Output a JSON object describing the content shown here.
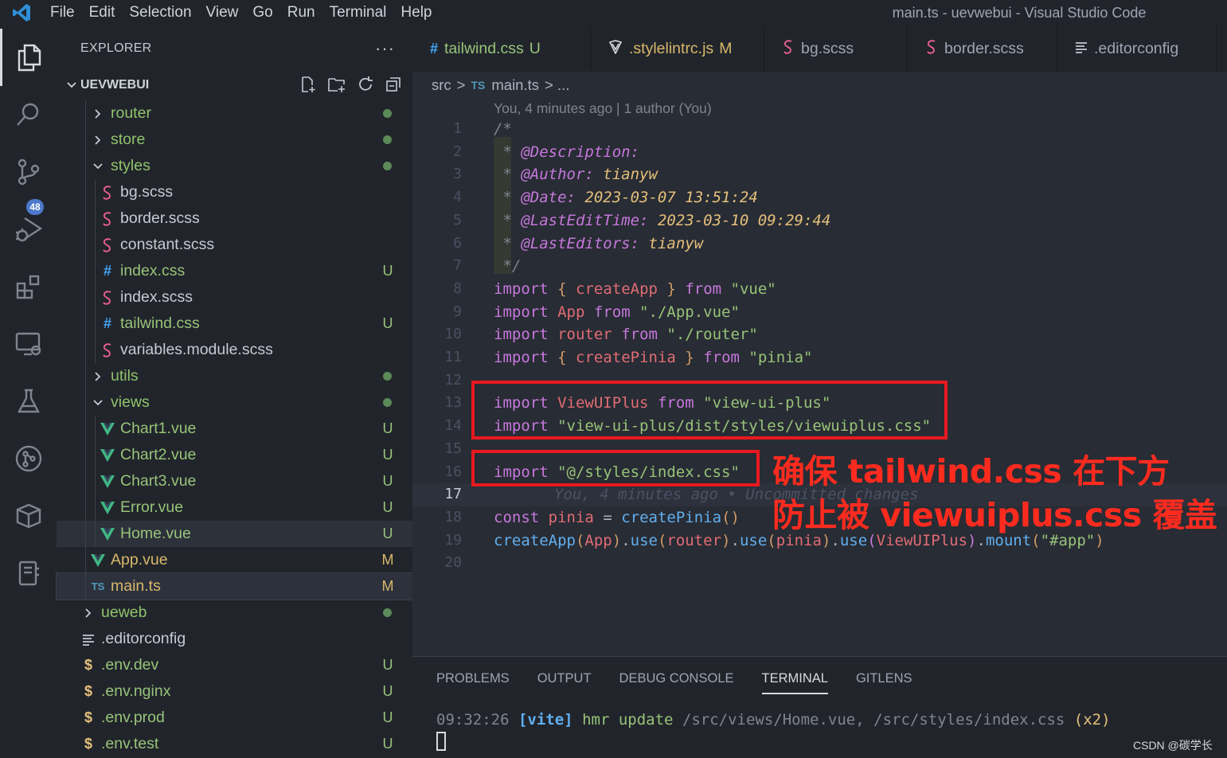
{
  "menu": {
    "items": [
      "File",
      "Edit",
      "Selection",
      "View",
      "Go",
      "Run",
      "Terminal",
      "Help"
    ],
    "window_title": "main.ts - uevwebui - Visual Studio Code"
  },
  "activity": {
    "source_control_badge": "48"
  },
  "explorer": {
    "title": "EXPLORER",
    "more": "···",
    "workspace": "UEVWEBUI",
    "items": [
      {
        "label": "router",
        "kind": "folder",
        "open": false,
        "status": "dot"
      },
      {
        "label": "store",
        "kind": "folder",
        "open": false,
        "status": "dot"
      },
      {
        "label": "styles",
        "kind": "folder",
        "open": true,
        "status": "dot"
      },
      {
        "label": "bg.scss",
        "kind": "scss",
        "status": ""
      },
      {
        "label": "border.scss",
        "kind": "scss",
        "status": ""
      },
      {
        "label": "constant.scss",
        "kind": "scss",
        "status": ""
      },
      {
        "label": "index.css",
        "kind": "css",
        "status": "U"
      },
      {
        "label": "index.scss",
        "kind": "scss",
        "status": ""
      },
      {
        "label": "tailwind.css",
        "kind": "css",
        "status": "U"
      },
      {
        "label": "variables.module.scss",
        "kind": "scss",
        "status": ""
      },
      {
        "label": "utils",
        "kind": "folder",
        "open": false,
        "status": "dot"
      },
      {
        "label": "views",
        "kind": "folder",
        "open": true,
        "status": "dot"
      },
      {
        "label": "Chart1.vue",
        "kind": "vue",
        "status": "U"
      },
      {
        "label": "Chart2.vue",
        "kind": "vue",
        "status": "U"
      },
      {
        "label": "Chart3.vue",
        "kind": "vue",
        "status": "U"
      },
      {
        "label": "Error.vue",
        "kind": "vue",
        "status": "U"
      },
      {
        "label": "Home.vue",
        "kind": "vue",
        "status": "U"
      },
      {
        "label": "App.vue",
        "kind": "vue",
        "status": "M"
      },
      {
        "label": "main.ts",
        "kind": "ts",
        "status": "M"
      },
      {
        "label": "ueweb",
        "kind": "folder",
        "open": false,
        "status": "dot"
      },
      {
        "label": ".editorconfig",
        "kind": "config",
        "status": ""
      },
      {
        "label": ".env.dev",
        "kind": "env",
        "status": "U"
      },
      {
        "label": ".env.nginx",
        "kind": "env",
        "status": "U"
      },
      {
        "label": ".env.prod",
        "kind": "env",
        "status": "U"
      },
      {
        "label": ".env.test",
        "kind": "env",
        "status": "U"
      }
    ]
  },
  "tabs": [
    {
      "label": "tailwind.css",
      "icon": "#",
      "flag": "U"
    },
    {
      "label": ".stylelintrc.js",
      "icon": "stylelint",
      "flag": "M"
    },
    {
      "label": "bg.scss",
      "icon": "scss",
      "flag": ""
    },
    {
      "label": "border.scss",
      "icon": "scss",
      "flag": ""
    },
    {
      "label": ".editorconfig",
      "icon": "config",
      "flag": ""
    }
  ],
  "breadcrumb": {
    "root": "src",
    "sep": ">",
    "file_icon": "TS",
    "file": "main.ts",
    "tail": "> ..."
  },
  "editor": {
    "blame_header": "You, 4 minutes ago | 1 author (You)",
    "line_numbers": [
      "1",
      "2",
      "3",
      "4",
      "5",
      "6",
      "7",
      "8",
      "9",
      "10",
      "11",
      "12",
      "13",
      "14",
      "15",
      "16",
      "17",
      "18",
      "19",
      "20"
    ],
    "current_line_blame": "You, 4 minutes ago • Uncommitted changes",
    "lines": {
      "l1": "/*",
      "l2_tag": "@Description:",
      "l3_tag": "@Author:",
      "l3_val": "tianyw",
      "l4_tag": "@Date:",
      "l4_val": "2023-03-07 13:51:24",
      "l5_tag": "@LastEditTime:",
      "l5_val": "2023-03-10 09:29:44",
      "l6_tag": "@LastEditors:",
      "l6_val": "tianyw",
      "l7": "*/",
      "import_kw": "import",
      "from_kw": "from",
      "const_kw": "const",
      "l8_name": "createApp",
      "l8_src": "\"vue\"",
      "l9_name": "App",
      "l9_src": "\"./App.vue\"",
      "l10_name": "router",
      "l10_src": "\"./router\"",
      "l11_name": "createPinia",
      "l11_src": "\"pinia\"",
      "l13_name": "ViewUIPlus",
      "l13_src": "\"view-ui-plus\"",
      "l14_src": "\"view-ui-plus/dist/styles/viewuiplus.css\"",
      "l16_src": "\"@/styles/index.css\"",
      "l18_var": "pinia",
      "l18_fn": "createPinia",
      "l19_fn1": "createApp",
      "l19_arg1": "App",
      "l19_use": "use",
      "l19_arg2": "router",
      "l19_arg3": "pinia",
      "l19_arg4": "ViewUIPlus",
      "l19_mount": "mount",
      "l19_sel": "\"#app\""
    }
  },
  "annotation": {
    "line1": "确保 tailwind.css 在下方",
    "line2": "防止被 viewuiplus.css 覆盖"
  },
  "panel": {
    "tabs": [
      "PROBLEMS",
      "OUTPUT",
      "DEBUG CONSOLE",
      "TERMINAL",
      "GITLENS"
    ],
    "active_tab": "TERMINAL",
    "term_time": "09:32:26",
    "term_tag": "[vite]",
    "term_msg": "hmr update",
    "term_paths": "/src/views/Home.vue, /src/styles/index.css",
    "term_count": "(x2)"
  },
  "watermark": "CSDN @碳学长",
  "colors": {
    "accent": "#4d78cc",
    "annotation_red": "#ff2b1f",
    "untracked_green": "#98c379",
    "modified_yellow": "#d9b86a"
  }
}
